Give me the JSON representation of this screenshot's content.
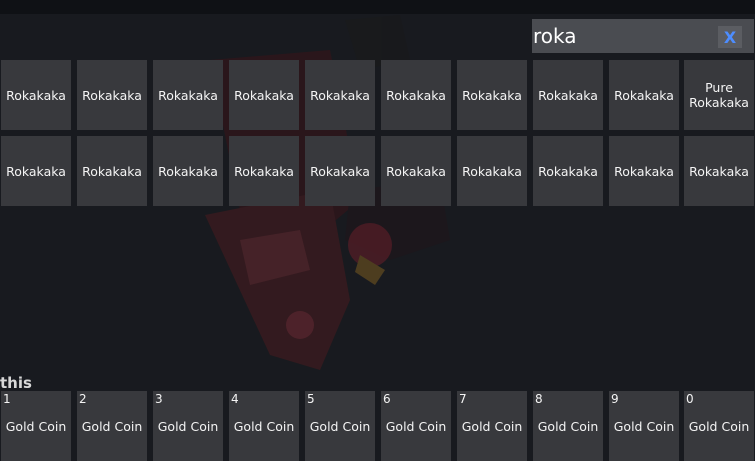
{
  "search": {
    "value": "roka",
    "clear_label": "X"
  },
  "inventory": {
    "row1": [
      "Rokakaka",
      "Rokakaka",
      "Rokakaka",
      "Rokakaka",
      "Rokakaka",
      "Rokakaka",
      "Rokakaka",
      "Rokakaka",
      "Rokakaka",
      "Pure Rokakaka"
    ],
    "row2": [
      "Rokakaka",
      "Rokakaka",
      "Rokakaka",
      "Rokakaka",
      "Rokakaka",
      "Rokakaka",
      "Rokakaka",
      "Rokakaka",
      "Rokakaka",
      "Rokakaka"
    ]
  },
  "hotbar": {
    "header": "this",
    "slots": [
      {
        "key": "1",
        "label": "Gold Coin"
      },
      {
        "key": "2",
        "label": "Gold Coin"
      },
      {
        "key": "3",
        "label": "Gold Coin"
      },
      {
        "key": "4",
        "label": "Gold Coin"
      },
      {
        "key": "5",
        "label": "Gold Coin"
      },
      {
        "key": "6",
        "label": "Gold Coin"
      },
      {
        "key": "7",
        "label": "Gold Coin"
      },
      {
        "key": "8",
        "label": "Gold Coin"
      },
      {
        "key": "9",
        "label": "Gold Coin"
      },
      {
        "key": "0",
        "label": "Gold Coin"
      }
    ]
  }
}
